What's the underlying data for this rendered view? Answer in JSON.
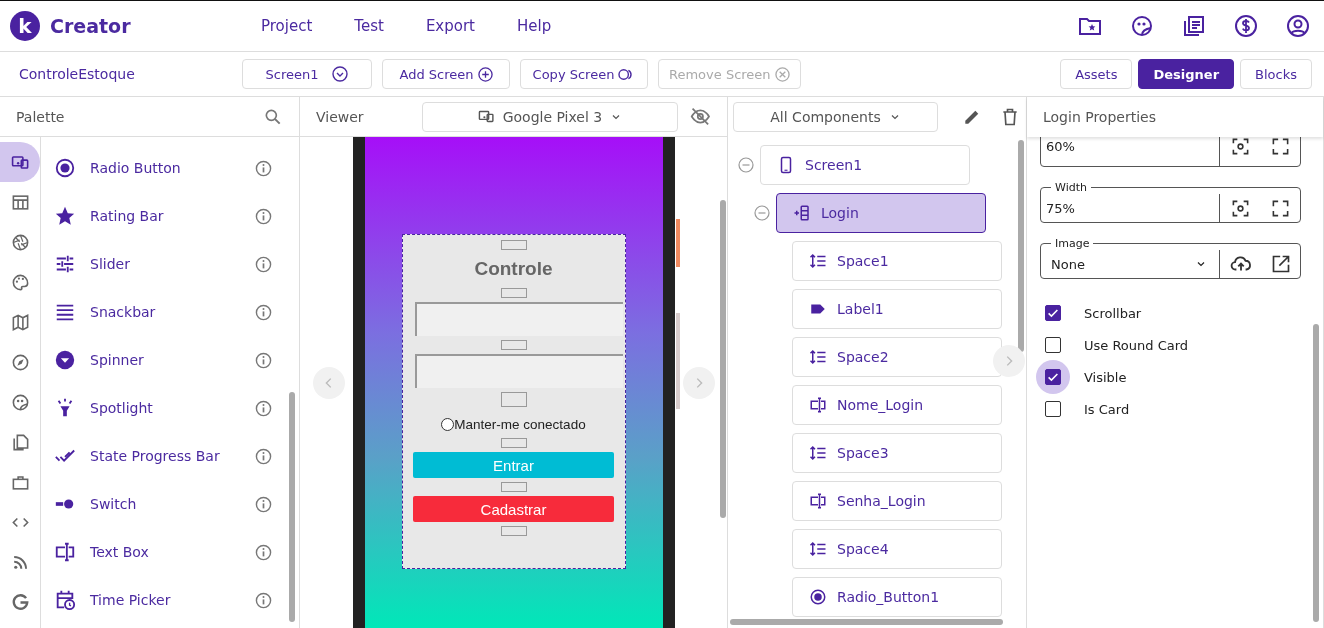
{
  "app": {
    "logo_letter": "k",
    "name": "Creator"
  },
  "menu": [
    "Project",
    "Test",
    "Export",
    "Help"
  ],
  "project_name": "ControleEstoque",
  "screen_selector": "Screen1",
  "screen_actions": [
    {
      "label": "Add Screen",
      "disabled": false
    },
    {
      "label": "Copy Screen",
      "disabled": false
    },
    {
      "label": "Remove Screen",
      "disabled": true
    }
  ],
  "views": [
    {
      "label": "Assets",
      "selected": false
    },
    {
      "label": "Designer",
      "selected": true
    },
    {
      "label": "Blocks",
      "selected": false
    }
  ],
  "palette": {
    "title": "Palette",
    "categories": [
      {
        "selected": true
      },
      {
        "selected": false
      },
      {
        "selected": false
      },
      {
        "selected": false
      },
      {
        "selected": false
      },
      {
        "selected": false
      },
      {
        "selected": false
      },
      {
        "selected": false
      },
      {
        "selected": false
      },
      {
        "selected": false
      },
      {
        "selected": false
      },
      {
        "selected": false
      }
    ],
    "items": [
      "Radio Button",
      "Rating Bar",
      "Slider",
      "Snackbar",
      "Spinner",
      "Spotlight",
      "State Progress Bar",
      "Switch",
      "Text Box",
      "Time Picker"
    ]
  },
  "viewer": {
    "title": "Viewer",
    "device": "Google Pixel 3",
    "app_screen": [
      {
        "kind": "spacer"
      },
      {
        "kind": "title",
        "text": "Controle"
      },
      {
        "kind": "spacer"
      },
      {
        "kind": "textbox"
      },
      {
        "kind": "spacer"
      },
      {
        "kind": "textbox"
      },
      {
        "kind": "spacer"
      },
      {
        "kind": "radio",
        "text": "Manter-me conectado",
        "checked": false
      },
      {
        "kind": "spacer"
      },
      {
        "kind": "button",
        "text": "Entrar",
        "color": "#00bcd4"
      },
      {
        "kind": "spacer"
      },
      {
        "kind": "button",
        "text": "Cadastrar",
        "color": "#f72b3b"
      },
      {
        "kind": "spacer"
      }
    ]
  },
  "components": {
    "filter": "All Components",
    "tree": [
      {
        "label": "Screen1",
        "kind": "screen",
        "selected": false,
        "expanded": true,
        "children": [
          {
            "label": "Login",
            "kind": "arrangement",
            "selected": true,
            "expanded": true,
            "children": [
              {
                "label": "Space1",
                "kind": "space",
                "selected": false
              },
              {
                "label": "Label1",
                "kind": "label",
                "selected": false
              },
              {
                "label": "Space2",
                "kind": "space",
                "selected": false
              },
              {
                "label": "Nome_Login",
                "kind": "textbox",
                "selected": false
              },
              {
                "label": "Space3",
                "kind": "space",
                "selected": false
              },
              {
                "label": "Senha_Login",
                "kind": "textbox",
                "selected": false
              },
              {
                "label": "Space4",
                "kind": "space",
                "selected": false
              },
              {
                "label": "Radio_Button1",
                "kind": "radio",
                "selected": false
              }
            ]
          }
        ]
      }
    ]
  },
  "properties": {
    "title": "Login Properties",
    "fields": [
      {
        "kind": "size",
        "value": "60%"
      },
      {
        "kind": "size",
        "label": "Width",
        "value": "75%"
      },
      {
        "kind": "image",
        "label": "Image",
        "value": "None"
      }
    ],
    "checkboxes": [
      {
        "label": "Scrollbar",
        "checked": true,
        "focused": false
      },
      {
        "label": "Use Round Card",
        "checked": false,
        "focused": false
      },
      {
        "label": "Visible",
        "checked": true,
        "focused": true
      },
      {
        "label": "Is Card",
        "checked": false,
        "focused": false
      }
    ]
  }
}
